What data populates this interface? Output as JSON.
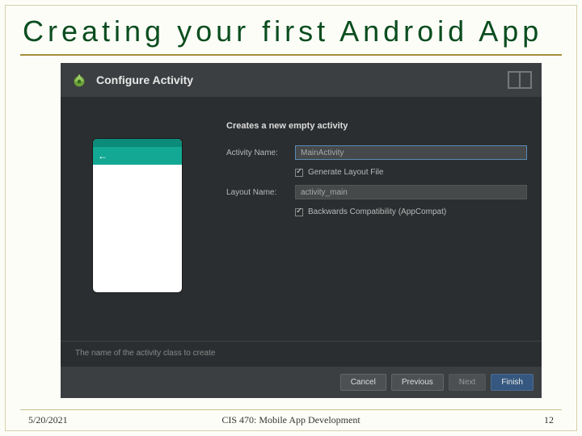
{
  "slide": {
    "title": "Creating your first Android App"
  },
  "dialog": {
    "header": "Configure Activity",
    "heading": "Creates a new empty activity",
    "activity_label": "Activity Name:",
    "activity_value": "MainActivity",
    "generate_label": "Generate Layout File",
    "layout_label": "Layout Name:",
    "layout_value": "activity_main",
    "compat_label": "Backwards Compatibility (AppCompat)",
    "hint": "The name of the activity class to create",
    "buttons": {
      "cancel": "Cancel",
      "previous": "Previous",
      "next": "Next",
      "finish": "Finish"
    }
  },
  "footer": {
    "date": "5/20/2021",
    "center": "CIS 470: Mobile App Development",
    "page": "12"
  }
}
